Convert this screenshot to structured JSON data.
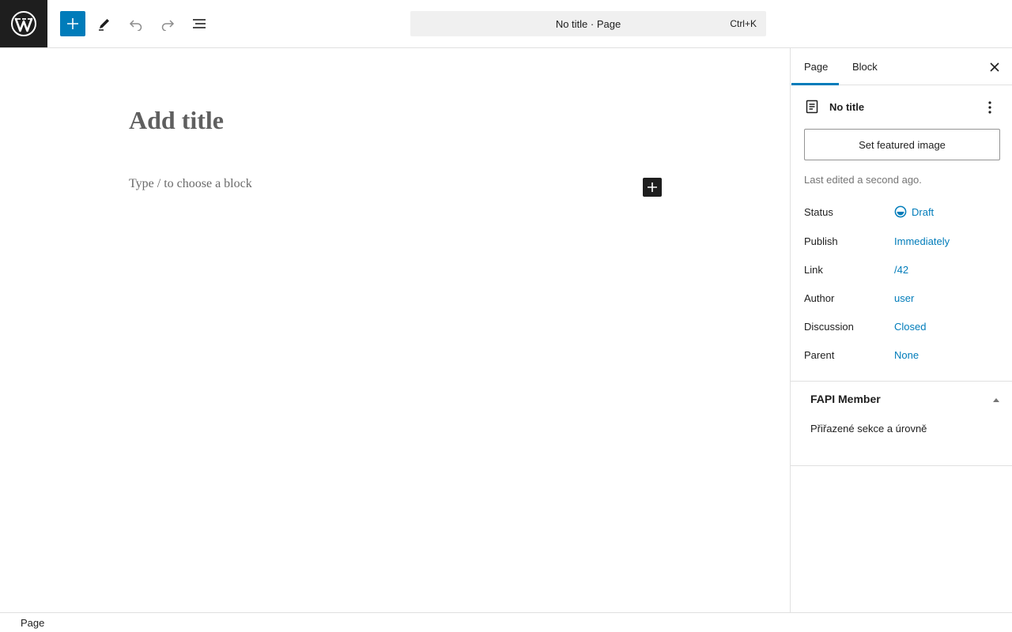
{
  "toolbar": {
    "document_title": "No title · Page",
    "shortcut": "Ctrl+K",
    "accent_color": "#007cba"
  },
  "editor": {
    "title_placeholder": "Add title",
    "block_placeholder": "Type / to choose a block"
  },
  "sidebar": {
    "tabs": [
      {
        "label": "Page",
        "active": true
      },
      {
        "label": "Block",
        "active": false
      }
    ],
    "document": {
      "title": "No title",
      "featured_image_button": "Set featured image",
      "last_edited": "Last edited a second ago."
    },
    "meta": {
      "status_label": "Status",
      "status_value": "Draft",
      "publish_label": "Publish",
      "publish_value": "Immediately",
      "link_label": "Link",
      "link_value": "/42",
      "author_label": "Author",
      "author_value": "user",
      "discussion_label": "Discussion",
      "discussion_value": "Closed",
      "parent_label": "Parent",
      "parent_value": "None"
    },
    "fapi_panel": {
      "title": "FAPI Member",
      "text": "Přiřazené sekce a úrovně"
    }
  },
  "footer": {
    "breadcrumb": "Page"
  },
  "icons": [
    "wordpress-logo-icon",
    "plus-icon",
    "pencil-icon",
    "undo-icon",
    "redo-icon",
    "list-view-icon",
    "close-icon",
    "page-icon",
    "more-vertical-icon",
    "draft-status-icon",
    "chevron-up-icon"
  ]
}
